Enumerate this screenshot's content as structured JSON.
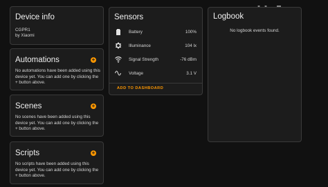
{
  "device_info": {
    "title": "Device info",
    "model": "CGPR1",
    "manufacturer": "by Xiaomi"
  },
  "automations": {
    "title": "Automations",
    "body": "No automations have been added using this device yet. You can add one by clicking the + button above."
  },
  "scenes": {
    "title": "Scenes",
    "body": "No scenes have been added using this device yet. You can add one by clicking the + button above."
  },
  "scripts": {
    "title": "Scripts",
    "body": "No scripts have been added using this device yet. You can add one by clicking the + button above."
  },
  "sensors": {
    "title": "Sensors",
    "rows": [
      {
        "name": "Battery",
        "value": "100%",
        "icon": "battery-icon"
      },
      {
        "name": "Illuminance",
        "value": "104 lx",
        "icon": "brightness-icon"
      },
      {
        "name": "Signal Strength",
        "value": "-76 dBm",
        "icon": "wifi-icon"
      },
      {
        "name": "Voltage",
        "value": "3.1 V",
        "icon": "sine-wave-icon"
      }
    ],
    "add_to_dashboard": "ADD TO DASHBOARD"
  },
  "logbook": {
    "title": "Logbook",
    "empty": "No logbook events found."
  },
  "colors": {
    "accent": "#ff9800",
    "background": "#111111",
    "card": "#1c1c1c"
  }
}
